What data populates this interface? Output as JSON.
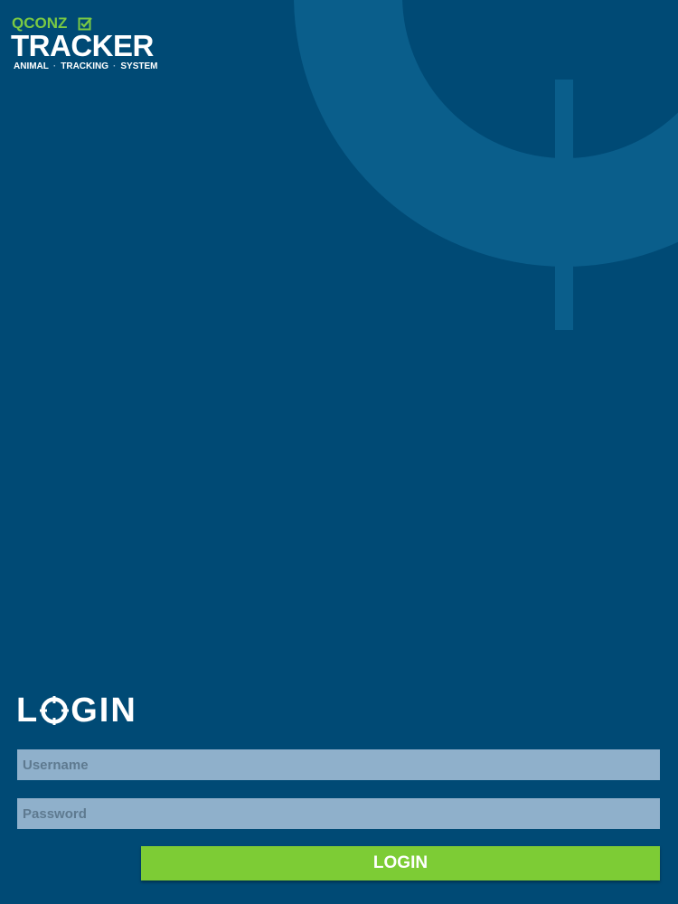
{
  "branding": {
    "brand_name": "QCONZ",
    "product_name": "TRACKER",
    "tagline": [
      "ANIMAL",
      "TRACKING",
      "SYSTEM"
    ]
  },
  "login_form": {
    "heading_prefix": "L",
    "heading_suffix": "GIN",
    "username_placeholder": "Username",
    "username_value": "",
    "password_placeholder": "Password",
    "password_value": "",
    "submit_label": "LOGIN"
  },
  "colors": {
    "background": "#004a75",
    "decoration": "#0a5e8b",
    "brand_green": "#7ac943",
    "button_green": "#7dcc35",
    "field_background": "#8fb0cb"
  },
  "icons": {
    "logo_check": "check-box-icon",
    "heading_o": "crosshair-icon",
    "background": "target-ring-graphic"
  }
}
